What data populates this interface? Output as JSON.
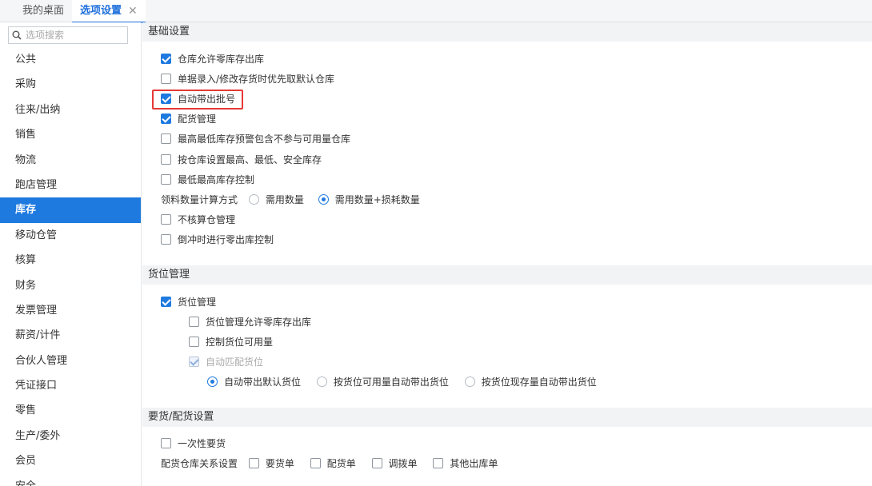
{
  "tabs": {
    "desktop": "我的桌面",
    "options": "选项设置",
    "close": "✕"
  },
  "sidebar": {
    "search_placeholder": "选项搜索",
    "items": [
      "公共",
      "采购",
      "往来/出纳",
      "销售",
      "物流",
      "跑店管理",
      "库存",
      "移动仓管",
      "核算",
      "财务",
      "发票管理",
      "薪资/计件",
      "合伙人管理",
      "凭证接口",
      "零售",
      "生产/委外",
      "会员",
      "安全"
    ],
    "active_index": 6
  },
  "sections": {
    "basic": {
      "title": "基础设置",
      "options": [
        {
          "label": "仓库允许零库存出库",
          "checked": true
        },
        {
          "label": "单据录入/修改存货时优先取默认仓库",
          "checked": false
        },
        {
          "label": "自动带出批号",
          "checked": true
        },
        {
          "label": "配货管理",
          "checked": true
        },
        {
          "label": "最高最低库存预警包含不参与可用量仓库",
          "checked": false
        },
        {
          "label": "按仓库设置最高、最低、安全库存",
          "checked": false
        },
        {
          "label": "最低最高库存控制",
          "checked": false
        }
      ],
      "calc_label": "领料数量计算方式",
      "calc_options": [
        {
          "label": "需用数量",
          "selected": false
        },
        {
          "label": "需用数量+损耗数量",
          "selected": true
        }
      ],
      "options2": [
        {
          "label": "不核算仓管理",
          "checked": false
        },
        {
          "label": "倒冲时进行零出库控制",
          "checked": false
        }
      ]
    },
    "location": {
      "title": "货位管理",
      "main_option": {
        "label": "货位管理",
        "checked": true
      },
      "sub_options": [
        {
          "label": "货位管理允许零库存出库",
          "checked": false
        },
        {
          "label": "控制货位可用量",
          "checked": false
        },
        {
          "label": "自动匹配货位",
          "checked": true,
          "disabled": true
        }
      ],
      "radio_options": [
        {
          "label": "自动带出默认货位",
          "selected": true
        },
        {
          "label": "按货位可用量自动带出货位",
          "selected": false
        },
        {
          "label": "按货位现存量自动带出货位",
          "selected": false
        }
      ]
    },
    "requisition": {
      "title": "要货/配货设置",
      "one_time": {
        "label": "一次性要货",
        "checked": false
      },
      "relation_label": "配货仓库关系设置",
      "relation_options": [
        {
          "label": "要货单",
          "checked": false
        },
        {
          "label": "配货单",
          "checked": false
        },
        {
          "label": "调拨单",
          "checked": false
        },
        {
          "label": "其他出库单",
          "checked": false
        }
      ]
    }
  },
  "colors": {
    "accent": "#1f7ae0",
    "highlight": "#e53935"
  }
}
